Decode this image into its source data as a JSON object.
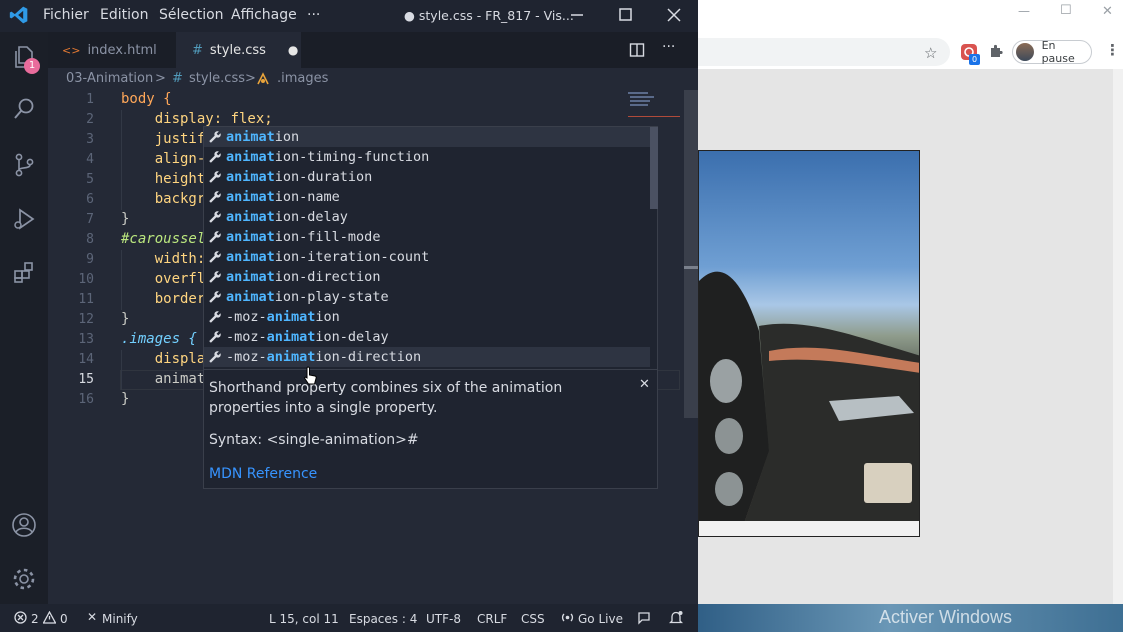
{
  "vscode": {
    "menu": [
      "Fichier",
      "Edition",
      "Sélection",
      "Affichage",
      "···"
    ],
    "window_title": "● style.css - FR_817 - Vis...",
    "activity_badge": "1",
    "tabs": [
      {
        "label": "index.html",
        "icon_glyph": "<>"
      },
      {
        "label": "style.css",
        "icon_glyph": "#",
        "dirty": "●"
      }
    ],
    "breadcrumb": [
      "03-Animation",
      ">",
      "#",
      "style.css",
      ">",
      ".images"
    ],
    "line_numbers": [
      "1",
      "2",
      "3",
      "4",
      "5",
      "6",
      "7",
      "8",
      "9",
      "10",
      "11",
      "12",
      "13",
      "14",
      "15",
      "16"
    ],
    "code_lines": [
      "body {",
      "    display: flex;",
      "    justif",
      "    align-",
      "    height",
      "    backgr",
      "}",
      "#caroussel",
      "    width:",
      "    overfl",
      "    border",
      "}",
      ".images {",
      "    displa",
      "    animat",
      "}"
    ],
    "suggestions": [
      {
        "pre": "",
        "match": "animat",
        "post": "ion"
      },
      {
        "pre": "",
        "match": "animat",
        "post": "ion-timing-function"
      },
      {
        "pre": "",
        "match": "animat",
        "post": "ion-duration"
      },
      {
        "pre": "",
        "match": "animat",
        "post": "ion-name"
      },
      {
        "pre": "",
        "match": "animat",
        "post": "ion-delay"
      },
      {
        "pre": "",
        "match": "animat",
        "post": "ion-fill-mode"
      },
      {
        "pre": "",
        "match": "animat",
        "post": "ion-iteration-count"
      },
      {
        "pre": "",
        "match": "animat",
        "post": "ion-direction"
      },
      {
        "pre": "",
        "match": "animat",
        "post": "ion-play-state"
      },
      {
        "pre": "-moz-",
        "match": "animat",
        "post": "ion"
      },
      {
        "pre": "-moz-",
        "match": "animat",
        "post": "ion-delay"
      },
      {
        "pre": "-moz-",
        "match": "animat",
        "post": "ion-direction"
      }
    ],
    "doc": {
      "description": "Shorthand property combines six of the animation properties into a single property.",
      "syntax": "Syntax: <single-animation>#",
      "link": "MDN Reference",
      "close": "✕"
    },
    "status": {
      "errors": "2",
      "warnings": "0",
      "minify": "Minify",
      "position": "L 15, col 11",
      "spaces": "Espaces : 4",
      "encoding": "UTF-8",
      "eol": "CRLF",
      "language": "CSS",
      "golive": "Go Live"
    }
  },
  "chrome": {
    "profile_label": "En pause",
    "extension_badge": "0",
    "window_controls": [
      "—",
      "☐",
      "✕"
    ]
  },
  "desktop": {
    "watermark": "Activer Windows"
  },
  "colors": {
    "accent": "#007acc",
    "highlight": "#4fb6ff",
    "badge": "#e96c9c"
  }
}
